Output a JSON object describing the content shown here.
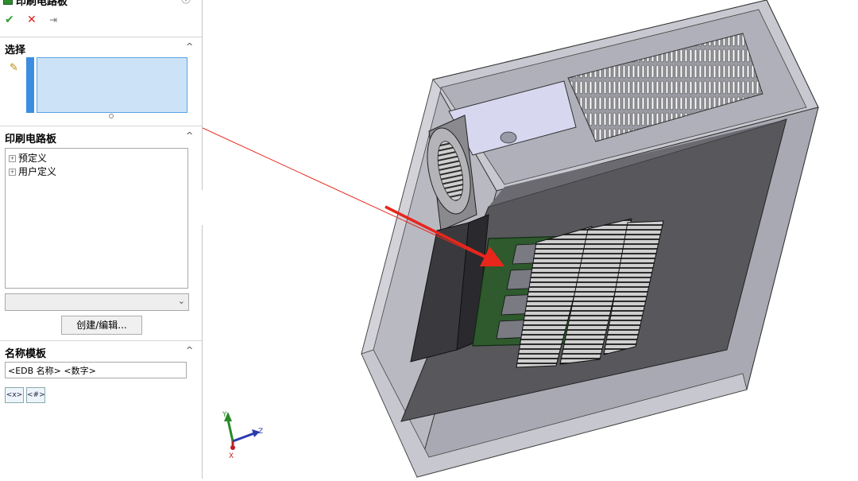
{
  "panel": {
    "title": "印刷电路板",
    "help_icon": "help-circle-icon",
    "actions": {
      "ok": "✔",
      "cancel": "✕",
      "pin": "⇥"
    },
    "selection": {
      "title": "选择",
      "toggle": "^"
    },
    "pcb_section": {
      "title": "印刷电路板",
      "toggle": "^",
      "tree": [
        "预定义",
        "用户定义"
      ],
      "dropdown_value": ""
    },
    "create_button": "创建/编辑...",
    "name_template": {
      "title": "名称模板",
      "toggle": "^",
      "value": "<EDB 名称> <数字>",
      "tokens": [
        "<x>",
        "<#>"
      ]
    }
  },
  "viewport": {
    "triad": {
      "y": "Y",
      "z": "Z",
      "x": "X"
    }
  },
  "colors": {
    "accent": "#3c8de0",
    "selection_bg": "#cce3f7",
    "arrow": "#e8261c",
    "ok": "#2ea02e",
    "cancel": "#e02020"
  }
}
